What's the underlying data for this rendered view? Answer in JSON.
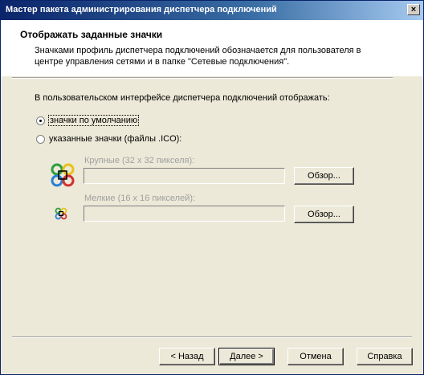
{
  "window": {
    "title": "Мастер пакета администрирования диспетчера подключений",
    "close_glyph": "×"
  },
  "header": {
    "title": "Отображать заданные значки",
    "description": "Значками профиль диспетчера подключений обозначается для пользователя в центре управления сетями и в папке \"Сетевые подключения\"."
  },
  "content": {
    "prompt": "В пользовательском интерфейсе диспетчера подключений отображать:",
    "radio_default": {
      "label": "значки по умолчанию",
      "checked": true
    },
    "radio_custom": {
      "label": "указанные значки (файлы .ICO):",
      "checked": false
    },
    "large_icon": {
      "label": "Крупные (32 x 32 пикселя):",
      "value": "",
      "browse": "Обзор..."
    },
    "small_icon": {
      "label": "Мелкие (16 x 16 пикселей):",
      "value": "",
      "browse": "Обзор..."
    },
    "icon_name": "connection-manager-icon",
    "icon_colors": [
      "#2e9e3e",
      "#e8c21a",
      "#d23030",
      "#2c7fd4"
    ]
  },
  "footer": {
    "back": "< Назад",
    "next": "Далее >",
    "cancel": "Отмена",
    "help": "Справка"
  }
}
